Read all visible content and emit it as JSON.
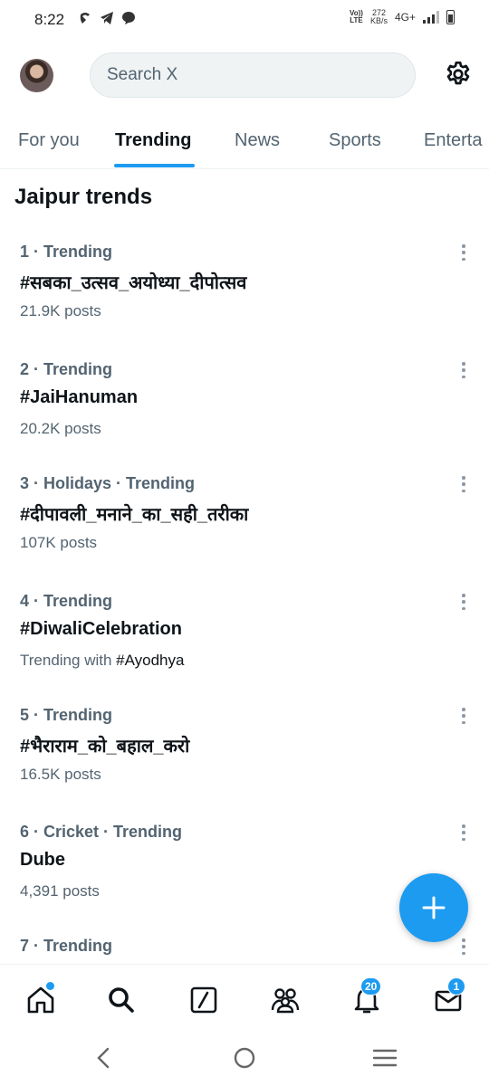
{
  "status_bar": {
    "time": "8:22",
    "volte_line1": "Vo))",
    "volte_line2": "LTE",
    "speed_value": "272",
    "speed_unit": "KB/s",
    "network": "4G+"
  },
  "header": {
    "search_placeholder": "Search X",
    "avatar_icon": "avatar",
    "settings_icon": "gear-icon"
  },
  "tabs": [
    {
      "label": "For you",
      "active": false
    },
    {
      "label": "Trending",
      "active": true
    },
    {
      "label": "News",
      "active": false
    },
    {
      "label": "Sports",
      "active": false
    },
    {
      "label": "Enterta",
      "active": false
    }
  ],
  "section_title": "Jaipur trends",
  "trends": [
    {
      "meta": "1 · Trending",
      "name": "#सबका_उत्सव_अयोध्या_दीपोत्सव",
      "sub": "21.9K posts"
    },
    {
      "meta": "2 · Trending",
      "name": "#JaiHanuman",
      "sub": "20.2K posts"
    },
    {
      "meta": "3 · Holidays · Trending",
      "name": "#दीपावली_मनाने_का_सही_तरीका",
      "sub": "107K posts"
    },
    {
      "meta": "4 · Trending",
      "name": "#DiwaliCelebration",
      "sub_prefix": "Trending with ",
      "sub_tag": "#Ayodhya"
    },
    {
      "meta": "5 · Trending",
      "name": "#भैराराम_को_बहाल_करो",
      "sub": "16.5K posts"
    },
    {
      "meta": "6 · Cricket · Trending",
      "name": "Dube",
      "sub": "4,391 posts"
    },
    {
      "meta": "7 · Trending",
      "name": "",
      "sub": ""
    }
  ],
  "fab": {
    "icon": "plus-icon"
  },
  "bottom_nav": {
    "notifications_badge": "20",
    "messages_badge": "1",
    "accent": "#1d9bf0"
  }
}
